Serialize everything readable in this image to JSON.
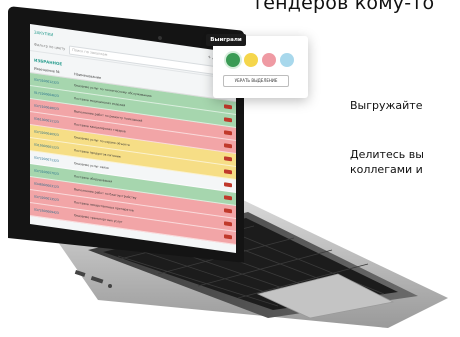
{
  "heading": "тендеров кому-то",
  "side_texts": {
    "line1": "Выгружайте",
    "line2": "Делитесь вы",
    "line3": "коллегами и"
  },
  "screen": {
    "app_title": "ЗАКУПКИ",
    "top_right": "+ добавить",
    "filter_label": "Фильтр по цвету",
    "filter_placeholder": "Поиск по закупкам",
    "section_title": "ИЗБРАННОЕ",
    "columns": [
      "Извещение №",
      "Наименование"
    ],
    "rows": [
      {
        "num": "0373100012323",
        "desc": "Оказание услуг по техническому обслуживанию",
        "color": "green"
      },
      {
        "num": "0172200004623",
        "desc": "Поставка медицинских изделий",
        "color": "green"
      },
      {
        "num": "0372100048023",
        "desc": "Выполнение работ по ремонту помещений",
        "color": "red"
      },
      {
        "num": "0361300011123",
        "desc": "Поставка канцелярских товаров",
        "color": "red"
      },
      {
        "num": "0373200040923",
        "desc": "Оказание услуг по охране объекта",
        "color": "yellow"
      },
      {
        "num": "0319300001223",
        "desc": "Поставка продуктов питания",
        "color": "yellow"
      },
      {
        "num": "0372200071323",
        "desc": "Оказание услуг связи",
        "color": "white"
      },
      {
        "num": "0373100057023",
        "desc": "Поставка оборудования",
        "color": "green"
      },
      {
        "num": "0348300003123",
        "desc": "Выполнение работ по благоустройству",
        "color": "red"
      },
      {
        "num": "0373200013523",
        "desc": "Поставка лекарственных препаратов",
        "color": "red"
      },
      {
        "num": "0372500009423",
        "desc": "Оказание транспортных услуг",
        "color": "red"
      }
    ],
    "popup": {
      "button": "Выиграли",
      "clear_button": "УБРАТЬ ВЫДЕЛЕНИЕ",
      "swatch_colors": [
        "#3a9b55",
        "#f5d64c",
        "#ef9aa3",
        "#a8d8ec"
      ]
    }
  }
}
